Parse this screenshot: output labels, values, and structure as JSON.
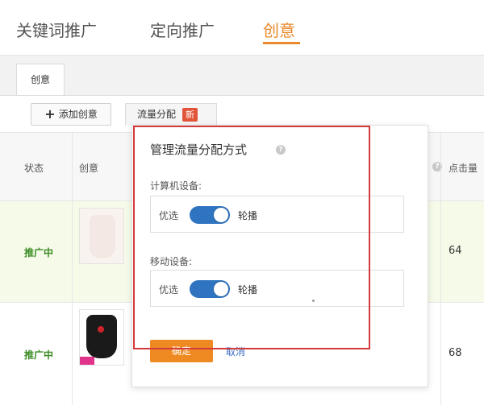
{
  "top_tabs": [
    {
      "label": "关键词推广"
    },
    {
      "label": "定向推广"
    },
    {
      "label": "创意"
    }
  ],
  "sub_tab": {
    "label": "创意"
  },
  "toolbar": {
    "add_label": "添加创意",
    "flow_label": "流量分配",
    "new_badge": "新"
  },
  "table": {
    "headers": {
      "status": "状态",
      "creative": "创意",
      "clicks": "点击量"
    },
    "rows": [
      {
        "status": "推广中",
        "clicks": "64"
      },
      {
        "status": "推广中",
        "clicks": "68"
      }
    ]
  },
  "popup": {
    "title": "管理流量分配方式",
    "computer_label": "计算机设备:",
    "mobile_label": "移动设备:",
    "opt_left": "优选",
    "opt_right": "轮播",
    "confirm_label": "确定",
    "cancel_label": "取消"
  },
  "colors": {
    "accent": "#e9892b",
    "toggle_on": "#2f74c0",
    "status_green": "#3a8a22",
    "highlight_red": "#d43a3a"
  },
  "toggles": {
    "computer_on": true,
    "mobile_on": true
  }
}
